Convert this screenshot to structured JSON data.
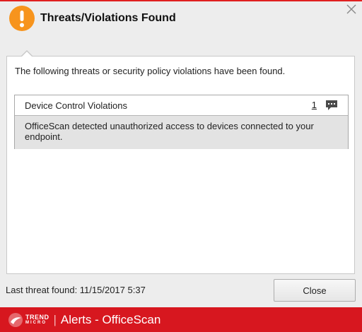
{
  "dialog": {
    "title": "Threats/Violations Found",
    "intro": "The following threats or security policy violations have been found."
  },
  "threats": [
    {
      "name": "Device Control Violations",
      "count": "1",
      "description": "OfficeScan detected unauthorized access to devices connected to your endpoint."
    }
  ],
  "footer": {
    "last_threat": "Last threat found: 11/15/2017 5:37",
    "close_label": "Close"
  },
  "brand": {
    "logo_top": "TREND",
    "logo_bottom": "MICRO",
    "separator": "|",
    "app_title": "Alerts - OfficeScan"
  },
  "icons": {
    "warning": "exclamation-circle-icon",
    "close": "close-icon",
    "details": "comment-icon",
    "logo": "trend-micro-logo-icon"
  },
  "colors": {
    "warning_orange": "#f7941d",
    "brand_red": "#d7171f",
    "description_bg": "#e3e3e3"
  }
}
